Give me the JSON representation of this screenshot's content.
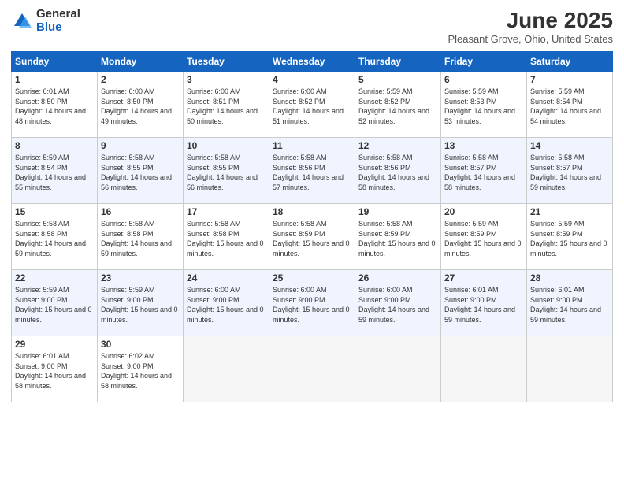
{
  "logo": {
    "general": "General",
    "blue": "Blue"
  },
  "title": "June 2025",
  "location": "Pleasant Grove, Ohio, United States",
  "headers": [
    "Sunday",
    "Monday",
    "Tuesday",
    "Wednesday",
    "Thursday",
    "Friday",
    "Saturday"
  ],
  "weeks": [
    [
      {
        "day": "1",
        "sunrise": "Sunrise: 6:01 AM",
        "sunset": "Sunset: 8:50 PM",
        "daylight": "Daylight: 14 hours and 48 minutes."
      },
      {
        "day": "2",
        "sunrise": "Sunrise: 6:00 AM",
        "sunset": "Sunset: 8:50 PM",
        "daylight": "Daylight: 14 hours and 49 minutes."
      },
      {
        "day": "3",
        "sunrise": "Sunrise: 6:00 AM",
        "sunset": "Sunset: 8:51 PM",
        "daylight": "Daylight: 14 hours and 50 minutes."
      },
      {
        "day": "4",
        "sunrise": "Sunrise: 6:00 AM",
        "sunset": "Sunset: 8:52 PM",
        "daylight": "Daylight: 14 hours and 51 minutes."
      },
      {
        "day": "5",
        "sunrise": "Sunrise: 5:59 AM",
        "sunset": "Sunset: 8:52 PM",
        "daylight": "Daylight: 14 hours and 52 minutes."
      },
      {
        "day": "6",
        "sunrise": "Sunrise: 5:59 AM",
        "sunset": "Sunset: 8:53 PM",
        "daylight": "Daylight: 14 hours and 53 minutes."
      },
      {
        "day": "7",
        "sunrise": "Sunrise: 5:59 AM",
        "sunset": "Sunset: 8:54 PM",
        "daylight": "Daylight: 14 hours and 54 minutes."
      }
    ],
    [
      {
        "day": "8",
        "sunrise": "Sunrise: 5:59 AM",
        "sunset": "Sunset: 8:54 PM",
        "daylight": "Daylight: 14 hours and 55 minutes."
      },
      {
        "day": "9",
        "sunrise": "Sunrise: 5:58 AM",
        "sunset": "Sunset: 8:55 PM",
        "daylight": "Daylight: 14 hours and 56 minutes."
      },
      {
        "day": "10",
        "sunrise": "Sunrise: 5:58 AM",
        "sunset": "Sunset: 8:55 PM",
        "daylight": "Daylight: 14 hours and 56 minutes."
      },
      {
        "day": "11",
        "sunrise": "Sunrise: 5:58 AM",
        "sunset": "Sunset: 8:56 PM",
        "daylight": "Daylight: 14 hours and 57 minutes."
      },
      {
        "day": "12",
        "sunrise": "Sunrise: 5:58 AM",
        "sunset": "Sunset: 8:56 PM",
        "daylight": "Daylight: 14 hours and 58 minutes."
      },
      {
        "day": "13",
        "sunrise": "Sunrise: 5:58 AM",
        "sunset": "Sunset: 8:57 PM",
        "daylight": "Daylight: 14 hours and 58 minutes."
      },
      {
        "day": "14",
        "sunrise": "Sunrise: 5:58 AM",
        "sunset": "Sunset: 8:57 PM",
        "daylight": "Daylight: 14 hours and 59 minutes."
      }
    ],
    [
      {
        "day": "15",
        "sunrise": "Sunrise: 5:58 AM",
        "sunset": "Sunset: 8:58 PM",
        "daylight": "Daylight: 14 hours and 59 minutes."
      },
      {
        "day": "16",
        "sunrise": "Sunrise: 5:58 AM",
        "sunset": "Sunset: 8:58 PM",
        "daylight": "Daylight: 14 hours and 59 minutes."
      },
      {
        "day": "17",
        "sunrise": "Sunrise: 5:58 AM",
        "sunset": "Sunset: 8:58 PM",
        "daylight": "Daylight: 15 hours and 0 minutes."
      },
      {
        "day": "18",
        "sunrise": "Sunrise: 5:58 AM",
        "sunset": "Sunset: 8:59 PM",
        "daylight": "Daylight: 15 hours and 0 minutes."
      },
      {
        "day": "19",
        "sunrise": "Sunrise: 5:58 AM",
        "sunset": "Sunset: 8:59 PM",
        "daylight": "Daylight: 15 hours and 0 minutes."
      },
      {
        "day": "20",
        "sunrise": "Sunrise: 5:59 AM",
        "sunset": "Sunset: 8:59 PM",
        "daylight": "Daylight: 15 hours and 0 minutes."
      },
      {
        "day": "21",
        "sunrise": "Sunrise: 5:59 AM",
        "sunset": "Sunset: 8:59 PM",
        "daylight": "Daylight: 15 hours and 0 minutes."
      }
    ],
    [
      {
        "day": "22",
        "sunrise": "Sunrise: 5:59 AM",
        "sunset": "Sunset: 9:00 PM",
        "daylight": "Daylight: 15 hours and 0 minutes."
      },
      {
        "day": "23",
        "sunrise": "Sunrise: 5:59 AM",
        "sunset": "Sunset: 9:00 PM",
        "daylight": "Daylight: 15 hours and 0 minutes."
      },
      {
        "day": "24",
        "sunrise": "Sunrise: 6:00 AM",
        "sunset": "Sunset: 9:00 PM",
        "daylight": "Daylight: 15 hours and 0 minutes."
      },
      {
        "day": "25",
        "sunrise": "Sunrise: 6:00 AM",
        "sunset": "Sunset: 9:00 PM",
        "daylight": "Daylight: 15 hours and 0 minutes."
      },
      {
        "day": "26",
        "sunrise": "Sunrise: 6:00 AM",
        "sunset": "Sunset: 9:00 PM",
        "daylight": "Daylight: 14 hours and 59 minutes."
      },
      {
        "day": "27",
        "sunrise": "Sunrise: 6:01 AM",
        "sunset": "Sunset: 9:00 PM",
        "daylight": "Daylight: 14 hours and 59 minutes."
      },
      {
        "day": "28",
        "sunrise": "Sunrise: 6:01 AM",
        "sunset": "Sunset: 9:00 PM",
        "daylight": "Daylight: 14 hours and 59 minutes."
      }
    ],
    [
      {
        "day": "29",
        "sunrise": "Sunrise: 6:01 AM",
        "sunset": "Sunset: 9:00 PM",
        "daylight": "Daylight: 14 hours and 58 minutes."
      },
      {
        "day": "30",
        "sunrise": "Sunrise: 6:02 AM",
        "sunset": "Sunset: 9:00 PM",
        "daylight": "Daylight: 14 hours and 58 minutes."
      },
      null,
      null,
      null,
      null,
      null
    ]
  ]
}
